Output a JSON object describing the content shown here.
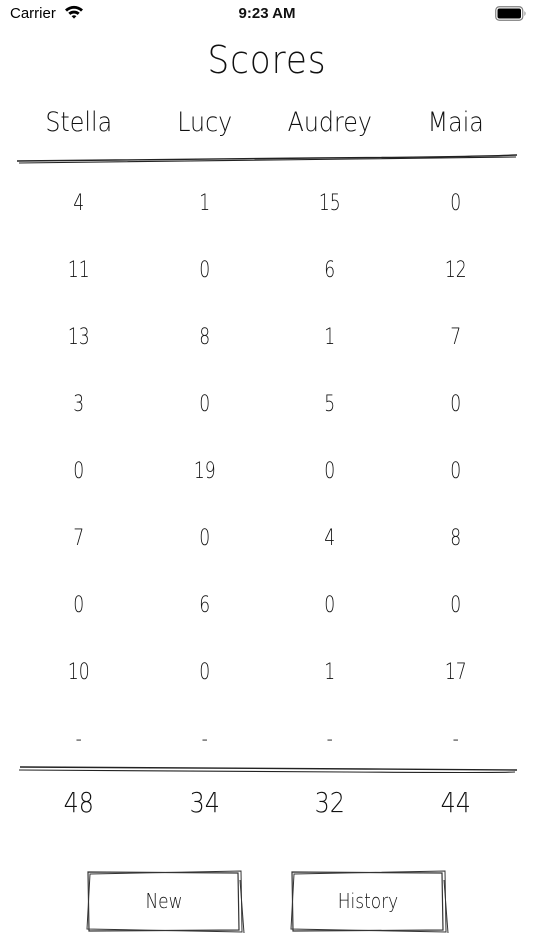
{
  "status_bar": {
    "carrier": "Carrier",
    "time": "9:23 AM"
  },
  "title": "Scores",
  "players": [
    "Stella",
    "Lucy",
    "Audrey",
    "Maia"
  ],
  "rounds": [
    [
      "4",
      "1",
      "15",
      "0"
    ],
    [
      "11",
      "0",
      "6",
      "12"
    ],
    [
      "13",
      "8",
      "1",
      "7"
    ],
    [
      "3",
      "0",
      "5",
      "0"
    ],
    [
      "0",
      "19",
      "0",
      "0"
    ],
    [
      "7",
      "0",
      "4",
      "8"
    ],
    [
      "0",
      "6",
      "0",
      "0"
    ],
    [
      "10",
      "0",
      "1",
      "17"
    ],
    [
      "-",
      "-",
      "-",
      "-"
    ]
  ],
  "totals": [
    "48",
    "34",
    "32",
    "44"
  ],
  "buttons": {
    "new_label": "New",
    "history_label": "History"
  }
}
